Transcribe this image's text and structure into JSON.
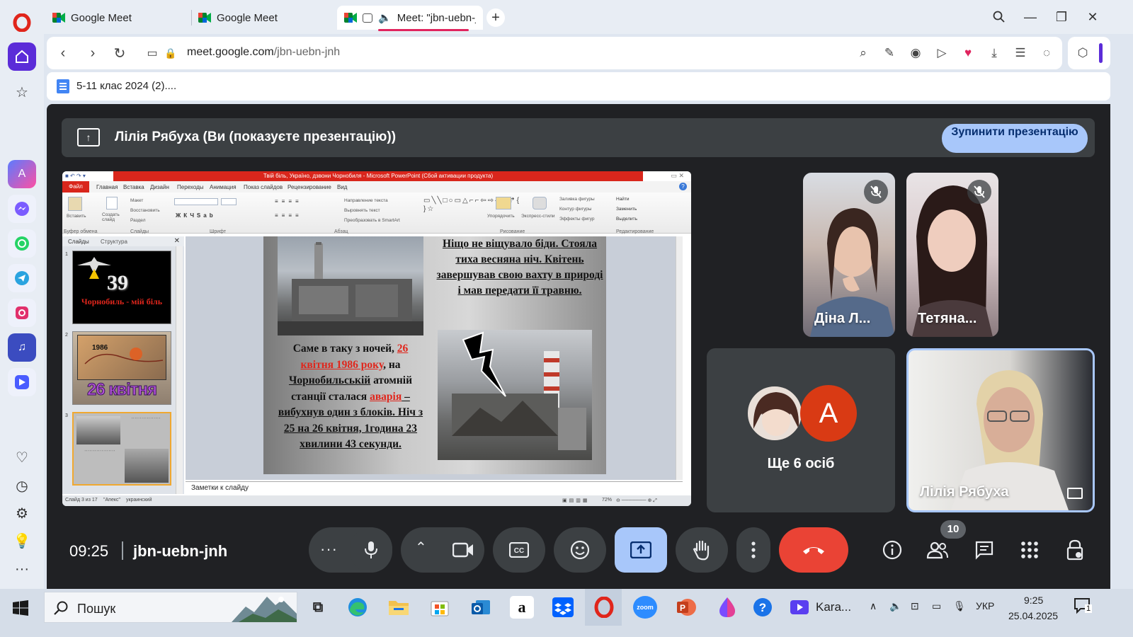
{
  "browser": {
    "tabs": [
      {
        "title": "Google Meet"
      },
      {
        "title": "Google Meet"
      },
      {
        "title": "Meet: \"jbn-uebn-jr"
      }
    ],
    "url_domain": "meet.google.com",
    "url_path": "/jbn-uebn-jnh",
    "bookmark": "5-11 клас 2024 (2)...."
  },
  "meet": {
    "banner_text": "Лілія Рябуха (Ви (показуєте презентацію))",
    "stop_button": "Зупинити презентацію",
    "time": "09:25",
    "meeting_code": "jbn-uebn-jnh",
    "participants_count": "10",
    "others_label": "Ще 6 осіб",
    "avatar_letter": "A",
    "tiles": [
      {
        "name": "Діна Л..."
      },
      {
        "name": "Тетяна..."
      },
      {
        "name": "Лілія Рябуха"
      }
    ]
  },
  "presentation": {
    "window_title": "Твій біль, Україно, дзвони Чорнобиля - Microsoft PowerPoint (Сбой активации продукта)",
    "menu": [
      "Файл",
      "Главная",
      "Вставка",
      "Дизайн",
      "Переходы",
      "Анимация",
      "Показ слайдов",
      "Рецензирование",
      "Вид"
    ],
    "ribbon_groups": [
      "Буфер обмена",
      "Слайды",
      "Шрифт",
      "Абзац",
      "Рисование",
      "Редактирование"
    ],
    "ribbon_items": {
      "paste": "Вставить",
      "create_slide": "Создать слайд",
      "layout": "Макет",
      "restore": "Восстановить",
      "section": "Раздел",
      "text_direction": "Направление текста",
      "align_text": "Выровнять текст",
      "smartart": "Преобразовать в SmartArt",
      "arrange": "Упорядочить",
      "quick_styles": "Экспресс-стили",
      "fill": "Заливка фигуры",
      "outline": "Контур фигуры",
      "effects": "Эффекты фигур",
      "find": "Найти",
      "replace": "Заменить",
      "select": "Выделить"
    },
    "left_tabs": [
      "Слайды",
      "Структура"
    ],
    "thumb1_title": "Чорнобиль - мій біль",
    "thumb1_number": "39",
    "thumb2_year": "1986",
    "thumb2_title": "26 квітня",
    "thumb_numbers": [
      "1",
      "2",
      "3"
    ],
    "slide_top_text": "Ніщо не віщувало біди. Стояла тиха весняна ніч. Квітень завершував свою вахту в природі і мав передати її травню.",
    "slide_left": {
      "p1": "Саме в таку з ночей,",
      "date": "26 квітня 1986 року",
      "p2": ", на",
      "p3": "Чорнобильській",
      "p4": "атомній станції сталася",
      "accident": "аварія",
      "p5": " – вибухнув один з блоків. Ніч з 25 на 26 квітня, 1година 23 хвилини 43 секунди."
    },
    "notes_placeholder": "Заметки к слайду",
    "status_slide": "Слайд 3 из 17",
    "status_theme": "\"Апекс\"",
    "status_lang": "украинский",
    "zoom": "72%"
  },
  "taskbar": {
    "search_placeholder": "Пошук",
    "zoom_app": "zoom",
    "karaoke_label": "Kara...",
    "language": "УКР",
    "time": "9:25",
    "date": "25.04.2025",
    "notif_count": "1"
  },
  "colors": {
    "meet_bg": "#202124",
    "stop_button": "#a8c7fa",
    "end_call": "#ea4335",
    "present_active": "#a8c7fa"
  }
}
